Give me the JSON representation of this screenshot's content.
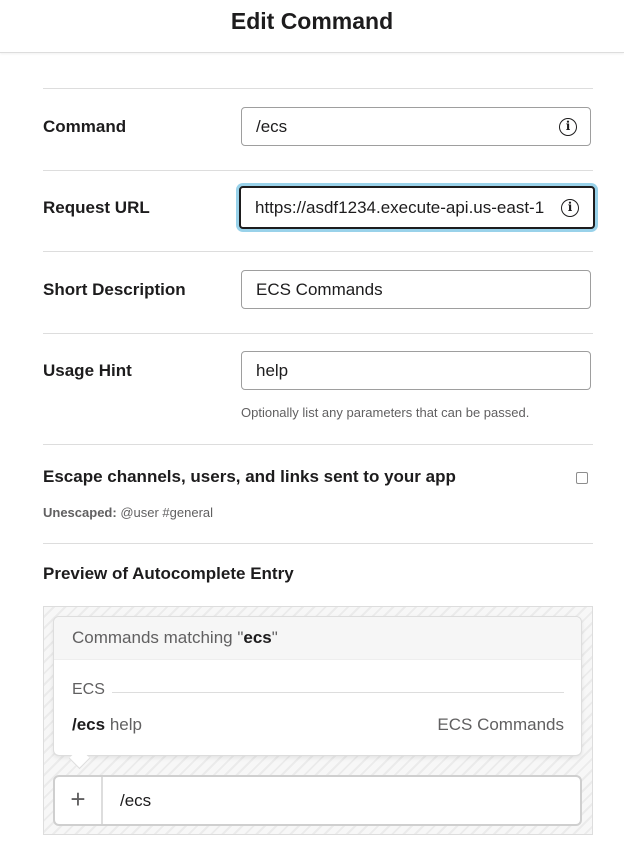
{
  "header": {
    "title": "Edit Command"
  },
  "form": {
    "command": {
      "label": "Command",
      "value": "/ecs"
    },
    "request_url": {
      "label": "Request URL",
      "value": "https://asdf1234.execute-api.us-east-1"
    },
    "short_description": {
      "label": "Short Description",
      "value": "ECS Commands"
    },
    "usage_hint": {
      "label": "Usage Hint",
      "value": "help",
      "help": "Optionally list any parameters that can be passed."
    },
    "escape": {
      "label": "Escape channels, users, and links sent to your app",
      "checked": false,
      "unescaped_label": "Unescaped:",
      "unescaped_example": "@user #general"
    }
  },
  "preview": {
    "title": "Preview of Autocomplete Entry",
    "matching_prefix": "Commands matching \"",
    "matching_term": "ecs",
    "matching_suffix": "\"",
    "group": "ECS",
    "row": {
      "command": "/ecs",
      "hint": "help",
      "description": "ECS Commands"
    },
    "composer": {
      "plus": "+",
      "text": "/ecs"
    }
  },
  "icons": {
    "info": "info-icon",
    "add": "plus-icon"
  },
  "colors": {
    "focus_ring": "#1d9bd1",
    "text": "#1d1c1d",
    "muted": "#616061"
  }
}
